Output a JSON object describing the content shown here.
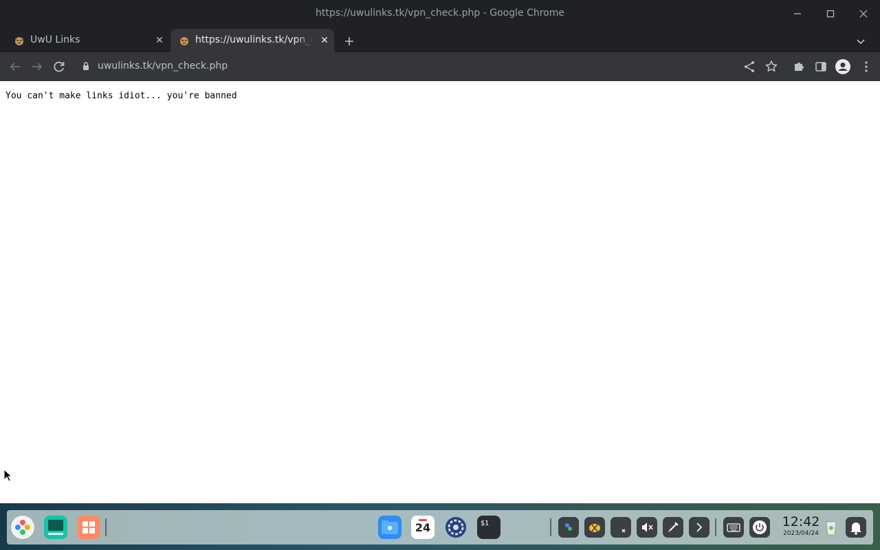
{
  "window": {
    "title": "https://uwulinks.tk/vpn_check.php - Google Chrome"
  },
  "tabs": [
    {
      "label": "UwU Links",
      "active": false
    },
    {
      "label": "https://uwulinks.tk/vpn_check.php",
      "active": true
    }
  ],
  "omnibox": {
    "url": "uwulinks.tk/vpn_check.php"
  },
  "page": {
    "message": "You can't make links idiot... you're banned"
  },
  "taskbar": {
    "calendar_day": "24",
    "time": "12:42",
    "date": "2023/04/24"
  },
  "colors": {
    "chrome_dark": "#202124",
    "toolbar": "#35363a",
    "text_light": "#e8eaed"
  }
}
